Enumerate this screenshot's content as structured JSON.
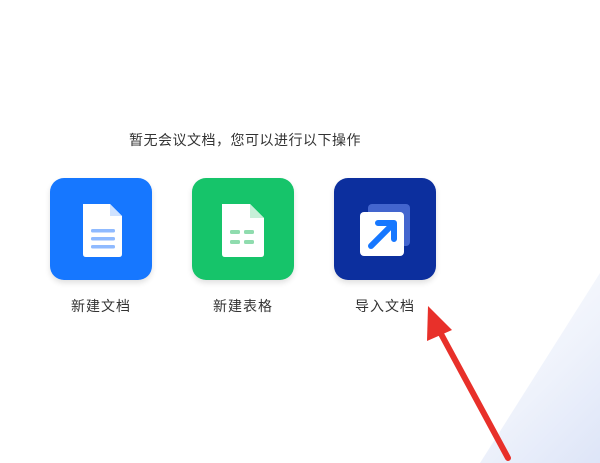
{
  "empty_state": {
    "message": "暂无会议文档，您可以进行以下操作"
  },
  "actions": [
    {
      "label": "新建文档",
      "icon": "document-icon",
      "color": "#1677ff"
    },
    {
      "label": "新建表格",
      "icon": "spreadsheet-icon",
      "color": "#16c46a"
    },
    {
      "label": "导入文档",
      "icon": "import-arrow-icon",
      "color": "#0c2f9e"
    }
  ],
  "annotation": {
    "arrow_color": "#e8302a"
  }
}
